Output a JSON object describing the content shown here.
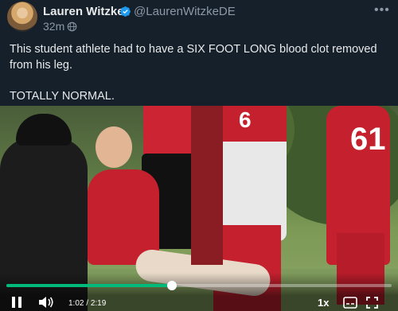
{
  "post": {
    "author_name": "Lauren Witzke",
    "author_handle": "@LaurenWitzkeDE",
    "timestamp": "32m",
    "text_line_1": "This student athlete had to have a SIX FOOT LONG blood clot removed from his leg.",
    "text_line_2": "TOTALLY NORMAL."
  },
  "video": {
    "elapsed": "1:02",
    "separator": "/",
    "duration": "2:19",
    "playback_speed": "1x",
    "progress_fraction": 0.43,
    "jersey_numbers": [
      "61",
      "6"
    ]
  },
  "colors": {
    "background": "#15202b",
    "text_primary": "#e7e9ea",
    "text_secondary": "#8b98a5",
    "verified_blue": "#1d9bf0",
    "progress_green": "#00ba7c",
    "jersey_red": "#c4202e"
  },
  "icons": {
    "verified": "verified-badge-icon",
    "audience": "globe-icon",
    "more": "more-options-icon",
    "pause": "pause-icon",
    "volume": "volume-icon",
    "captions": "captions-icon",
    "fullscreen": "fullscreen-icon"
  }
}
